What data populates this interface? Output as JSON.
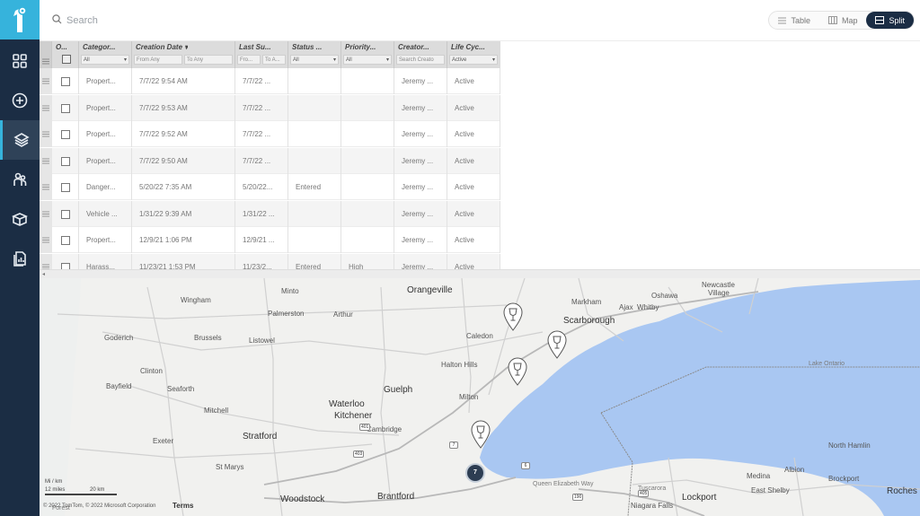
{
  "topbar": {
    "search_placeholder": "Search",
    "views": [
      {
        "label": "Table",
        "icon": "list-icon",
        "active": false
      },
      {
        "label": "Map",
        "icon": "map-icon",
        "active": false
      },
      {
        "label": "Split",
        "icon": "split-icon",
        "active": true
      }
    ]
  },
  "sidebar": {
    "items": [
      {
        "icon": "dashboard-grid-icon",
        "active": false
      },
      {
        "icon": "add-circle-icon",
        "active": false
      },
      {
        "icon": "layers-icon",
        "active": true
      },
      {
        "icon": "people-icon",
        "active": false
      },
      {
        "icon": "box-icon",
        "active": false
      },
      {
        "icon": "report-icon",
        "active": false
      }
    ]
  },
  "grid": {
    "columns": [
      {
        "title": "O...",
        "filter": ""
      },
      {
        "title": "Categor...",
        "filter": "All"
      },
      {
        "title": "Creation Date",
        "filter_from": "From Any",
        "filter_to": "To Any"
      },
      {
        "title": "Last Su...",
        "filter_from": "Fro...",
        "filter_to": "To A..."
      },
      {
        "title": "Status ...",
        "filter": "All"
      },
      {
        "title": "Priority...",
        "filter": "All"
      },
      {
        "title": "Creator...",
        "filter": "Search Creato"
      },
      {
        "title": "Life Cyc...",
        "filter": "Active"
      }
    ],
    "rows": [
      {
        "category": "Propert...",
        "created": "7/7/22 9:54 AM",
        "last": "7/7/22 ...",
        "status": "",
        "priority": "",
        "creator": "Jeremy ...",
        "lifecycle": "Active"
      },
      {
        "category": "Propert...",
        "created": "7/7/22 9:53 AM",
        "last": "7/7/22 ...",
        "status": "",
        "priority": "",
        "creator": "Jeremy ...",
        "lifecycle": "Active"
      },
      {
        "category": "Propert...",
        "created": "7/7/22 9:52 AM",
        "last": "7/7/22 ...",
        "status": "",
        "priority": "",
        "creator": "Jeremy ...",
        "lifecycle": "Active"
      },
      {
        "category": "Propert...",
        "created": "7/7/22 9:50 AM",
        "last": "7/7/22 ...",
        "status": "",
        "priority": "",
        "creator": "Jeremy ...",
        "lifecycle": "Active"
      },
      {
        "category": "Danger...",
        "created": "5/20/22 7:35 AM",
        "last": "5/20/22...",
        "status": "Entered",
        "priority": "",
        "creator": "Jeremy ...",
        "lifecycle": "Active"
      },
      {
        "category": "Vehicle ...",
        "created": "1/31/22 9:39 AM",
        "last": "1/31/22 ...",
        "status": "",
        "priority": "",
        "creator": "Jeremy ...",
        "lifecycle": "Active"
      },
      {
        "category": "Propert...",
        "created": "12/9/21 1:06 PM",
        "last": "12/9/21 ...",
        "status": "",
        "priority": "",
        "creator": "Jeremy ...",
        "lifecycle": "Active"
      },
      {
        "category": "Harass...",
        "created": "11/23/21 1:53 PM",
        "last": "11/23/2...",
        "status": "Entered",
        "priority": "High",
        "creator": "Jeremy ...",
        "lifecycle": "Active"
      }
    ]
  },
  "map": {
    "cities": [
      {
        "name": "Orangeville"
      },
      {
        "name": "Minto"
      },
      {
        "name": "Wingham"
      },
      {
        "name": "Palmerston"
      },
      {
        "name": "Arthur"
      },
      {
        "name": "Goderich"
      },
      {
        "name": "Brussels"
      },
      {
        "name": "Listowel"
      },
      {
        "name": "Clinton"
      },
      {
        "name": "Bayfield"
      },
      {
        "name": "Seaforth"
      },
      {
        "name": "Mitchell"
      },
      {
        "name": "Exeter"
      },
      {
        "name": "Stratford"
      },
      {
        "name": "St Marys"
      },
      {
        "name": "Woodstock"
      },
      {
        "name": "Brantford"
      },
      {
        "name": "Guelph"
      },
      {
        "name": "Waterloo"
      },
      {
        "name": "Kitchener"
      },
      {
        "name": "Cambridge"
      },
      {
        "name": "Milton"
      },
      {
        "name": "Halton Hills"
      },
      {
        "name": "Caledon"
      },
      {
        "name": "Markham"
      },
      {
        "name": "Scarborough"
      },
      {
        "name": "Ajax"
      },
      {
        "name": "Whitby"
      },
      {
        "name": "Oshawa"
      },
      {
        "name": "Newcastle"
      },
      {
        "name": "Village"
      },
      {
        "name": "Lake Ontario"
      },
      {
        "name": "North Hamlin"
      },
      {
        "name": "Albion"
      },
      {
        "name": "Brockport"
      },
      {
        "name": "Medina"
      },
      {
        "name": "East Shelby"
      },
      {
        "name": "Lockport"
      },
      {
        "name": "Niagara Falls"
      },
      {
        "name": "Roches"
      },
      {
        "name": "Queen Elizabeth Way"
      },
      {
        "name": "Tuscarora"
      },
      {
        "name": "Forest"
      }
    ],
    "cluster_count": "7",
    "scale_miles": "12 miles",
    "scale_km": "20 km",
    "scale_label": "Mi / km",
    "copyright": "© 2022 TomTom, © 2022 Microsoft Corporation",
    "terms": "Terms",
    "highways": [
      "401",
      "403",
      "7",
      "6",
      "405",
      "190"
    ]
  },
  "colors": {
    "sidebar": "#1b2d44",
    "logo": "#36b3dc",
    "water": "#a9c7f2",
    "land": "#f2f2f0"
  }
}
